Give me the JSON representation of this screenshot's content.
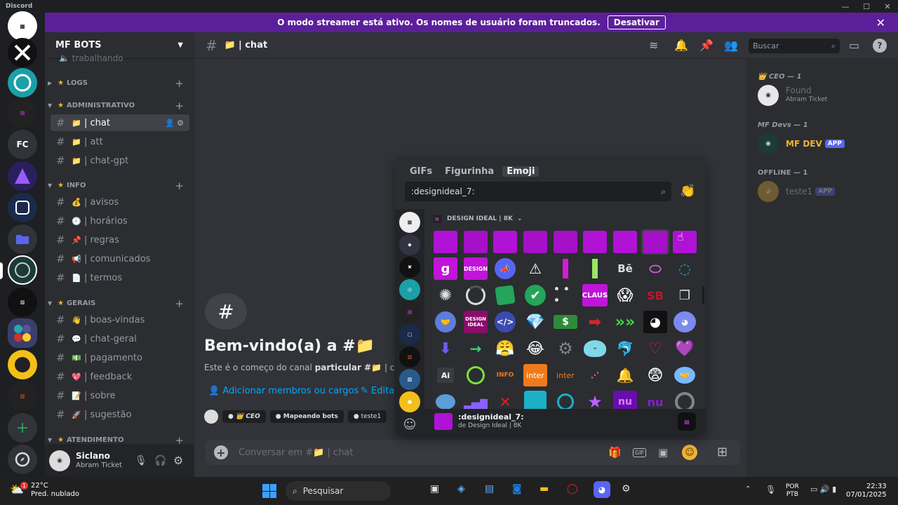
{
  "window": {
    "title": "Discord",
    "min": "—",
    "max": "☐",
    "close": "✕"
  },
  "banner": {
    "text": "O modo streamer está ativo. Os nomes de usuário foram truncados.",
    "button": "Desativar"
  },
  "guilds": [
    {
      "label": "FC"
    }
  ],
  "server": {
    "name": "MF BOTS",
    "partial_channel": "trabalhando"
  },
  "categories": [
    {
      "name": "LOGS"
    },
    {
      "name": "ADMINISTRATIVO"
    },
    {
      "name": "INFO"
    },
    {
      "name": "GERAIS"
    },
    {
      "name": "ATENDIMENTO"
    }
  ],
  "channels": [
    {
      "emoji": "📁",
      "name": "| chat"
    },
    {
      "emoji": "📁",
      "name": "| att"
    },
    {
      "emoji": "📁",
      "name": "| chat-gpt"
    },
    {
      "emoji": "💰",
      "name": "| avisos"
    },
    {
      "emoji": "🕘",
      "name": "| horários"
    },
    {
      "emoji": "📌",
      "name": "| regras"
    },
    {
      "emoji": "📢",
      "name": "| comunicados"
    },
    {
      "emoji": "📄",
      "name": "| termos"
    },
    {
      "emoji": "👋",
      "name": "| boas-vindas"
    },
    {
      "emoji": "💬",
      "name": "| chat-geral"
    },
    {
      "emoji": "💵",
      "name": "| pagamento"
    },
    {
      "emoji": "💖",
      "name": "| feedback"
    },
    {
      "emoji": "📝",
      "name": "| sobre"
    },
    {
      "emoji": "🚀",
      "name": "| sugestão"
    }
  ],
  "user": {
    "name": "Siclano",
    "status": "Abram Ticket"
  },
  "header": {
    "channel_emoji": "📁",
    "channel": "| chat",
    "search_placeholder": "Buscar"
  },
  "welcome": {
    "title": "Bem-vindo(a) a #",
    "subtitle_prefix": "Este é o começo do canal ",
    "subtitle_bold": "particular #",
    "subtitle_tail": " | c",
    "add_members": "Adicionar membros ou cargos",
    "edit": "Edita",
    "tags": [
      "CEO",
      "Mapeando bots",
      "teste1"
    ]
  },
  "composer": {
    "placeholder": "Conversar em #📁 | chat"
  },
  "members": {
    "groups": [
      {
        "title": "CEO — 1"
      },
      {
        "title": "MF Devs — 1"
      },
      {
        "title": "OFFLINE — 1"
      }
    ],
    "list": [
      {
        "name": "Found",
        "status": "Abram Ticket"
      },
      {
        "name": "MF DEV",
        "badge": "APP"
      },
      {
        "name": "teste1",
        "badge": "APP"
      }
    ]
  },
  "picker": {
    "tabs": [
      "GIFs",
      "Figurinha",
      "Emoji"
    ],
    "search_value": ":designideal_7:",
    "section": "DESIGN IDEAL | 8K",
    "preview_name": ":designideal_7:",
    "preview_source": "de Design Ideal | 8K",
    "text_emojis": {
      "g": "g",
      "design": "DESIGN",
      "be": "Bē",
      "claus": "CLAUS",
      "sb": "SB",
      "ai": "Ai",
      "info": "INFO",
      "inter1": "inter",
      "inter2": "inter",
      "design2": "DESIGN IDEAL"
    }
  },
  "taskbar": {
    "temp": "22°C",
    "weather": "Pred. nublado",
    "search": "Pesquisar",
    "lang1": "POR",
    "lang2": "PTB",
    "time": "22:33",
    "date": "07/01/2025",
    "notif": "1"
  }
}
